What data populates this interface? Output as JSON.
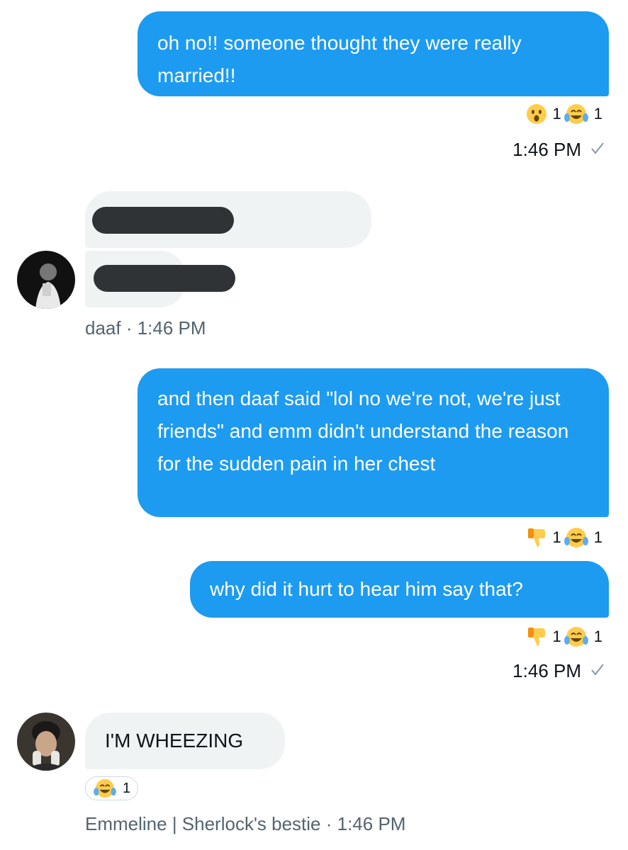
{
  "messages": [
    {
      "text": "oh no!! someone thought they were really married!!",
      "reactions": [
        {
          "icon": "astonished-face",
          "count": "1"
        },
        {
          "icon": "tears-of-joy-face",
          "count": "1"
        }
      ],
      "timestamp": "1:46 PM"
    },
    {
      "sender_meta": "daaf · 1:46 PM"
    },
    {
      "text": "and then daaf said \"lol no we're not, we're just friends\" and emm didn't understand the reason for the sudden pain in her chest",
      "reactions": [
        {
          "icon": "thumbs-down",
          "count": "1"
        },
        {
          "icon": "tears-of-joy-face",
          "count": "1"
        }
      ]
    },
    {
      "text": "why did it hurt to hear him say that?",
      "reactions": [
        {
          "icon": "thumbs-down",
          "count": "1"
        },
        {
          "icon": "tears-of-joy-face",
          "count": "1"
        }
      ],
      "timestamp": "1:46 PM"
    },
    {
      "text": "I'M WHEEZING",
      "reactions": [
        {
          "icon": "tears-of-joy-face",
          "count": "1"
        }
      ],
      "sender_meta": "Emmeline | Sherlock's bestie · 1:46 PM"
    }
  ],
  "colors": {
    "outgoing_bubble": "#1d9bf0",
    "incoming_bubble": "#eff3f4",
    "meta_text": "#536471",
    "redaction": "#2f3336"
  }
}
